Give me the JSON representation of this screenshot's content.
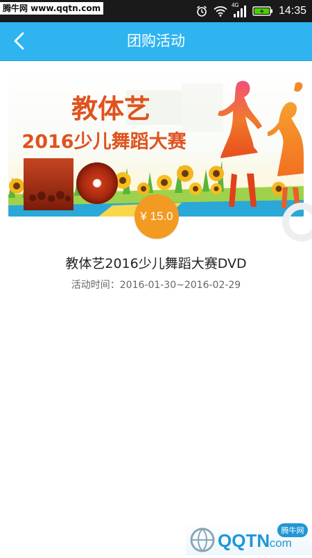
{
  "status_bar": {
    "watermark_top": "腾牛网 www.qqtn.com",
    "network": "4G",
    "time": "14:35"
  },
  "header": {
    "back_icon": "chevron-left-icon",
    "title": "团购活动"
  },
  "banner": {
    "title_line1": "教体艺",
    "title_line2": "2016少儿舞蹈大赛"
  },
  "item": {
    "price": "¥ 15.0",
    "name": "教体艺2016少儿舞蹈大赛DVD",
    "period": "活动时间：2016-01-30~2016-02-29"
  },
  "watermark_bottom": {
    "brand": "QQTN",
    "domain_suffix": ".com",
    "badge": "腾牛网"
  },
  "colors": {
    "appbar": "#2fb4f0",
    "price_badge": "#f39a22",
    "banner_text": "#e0521e"
  }
}
